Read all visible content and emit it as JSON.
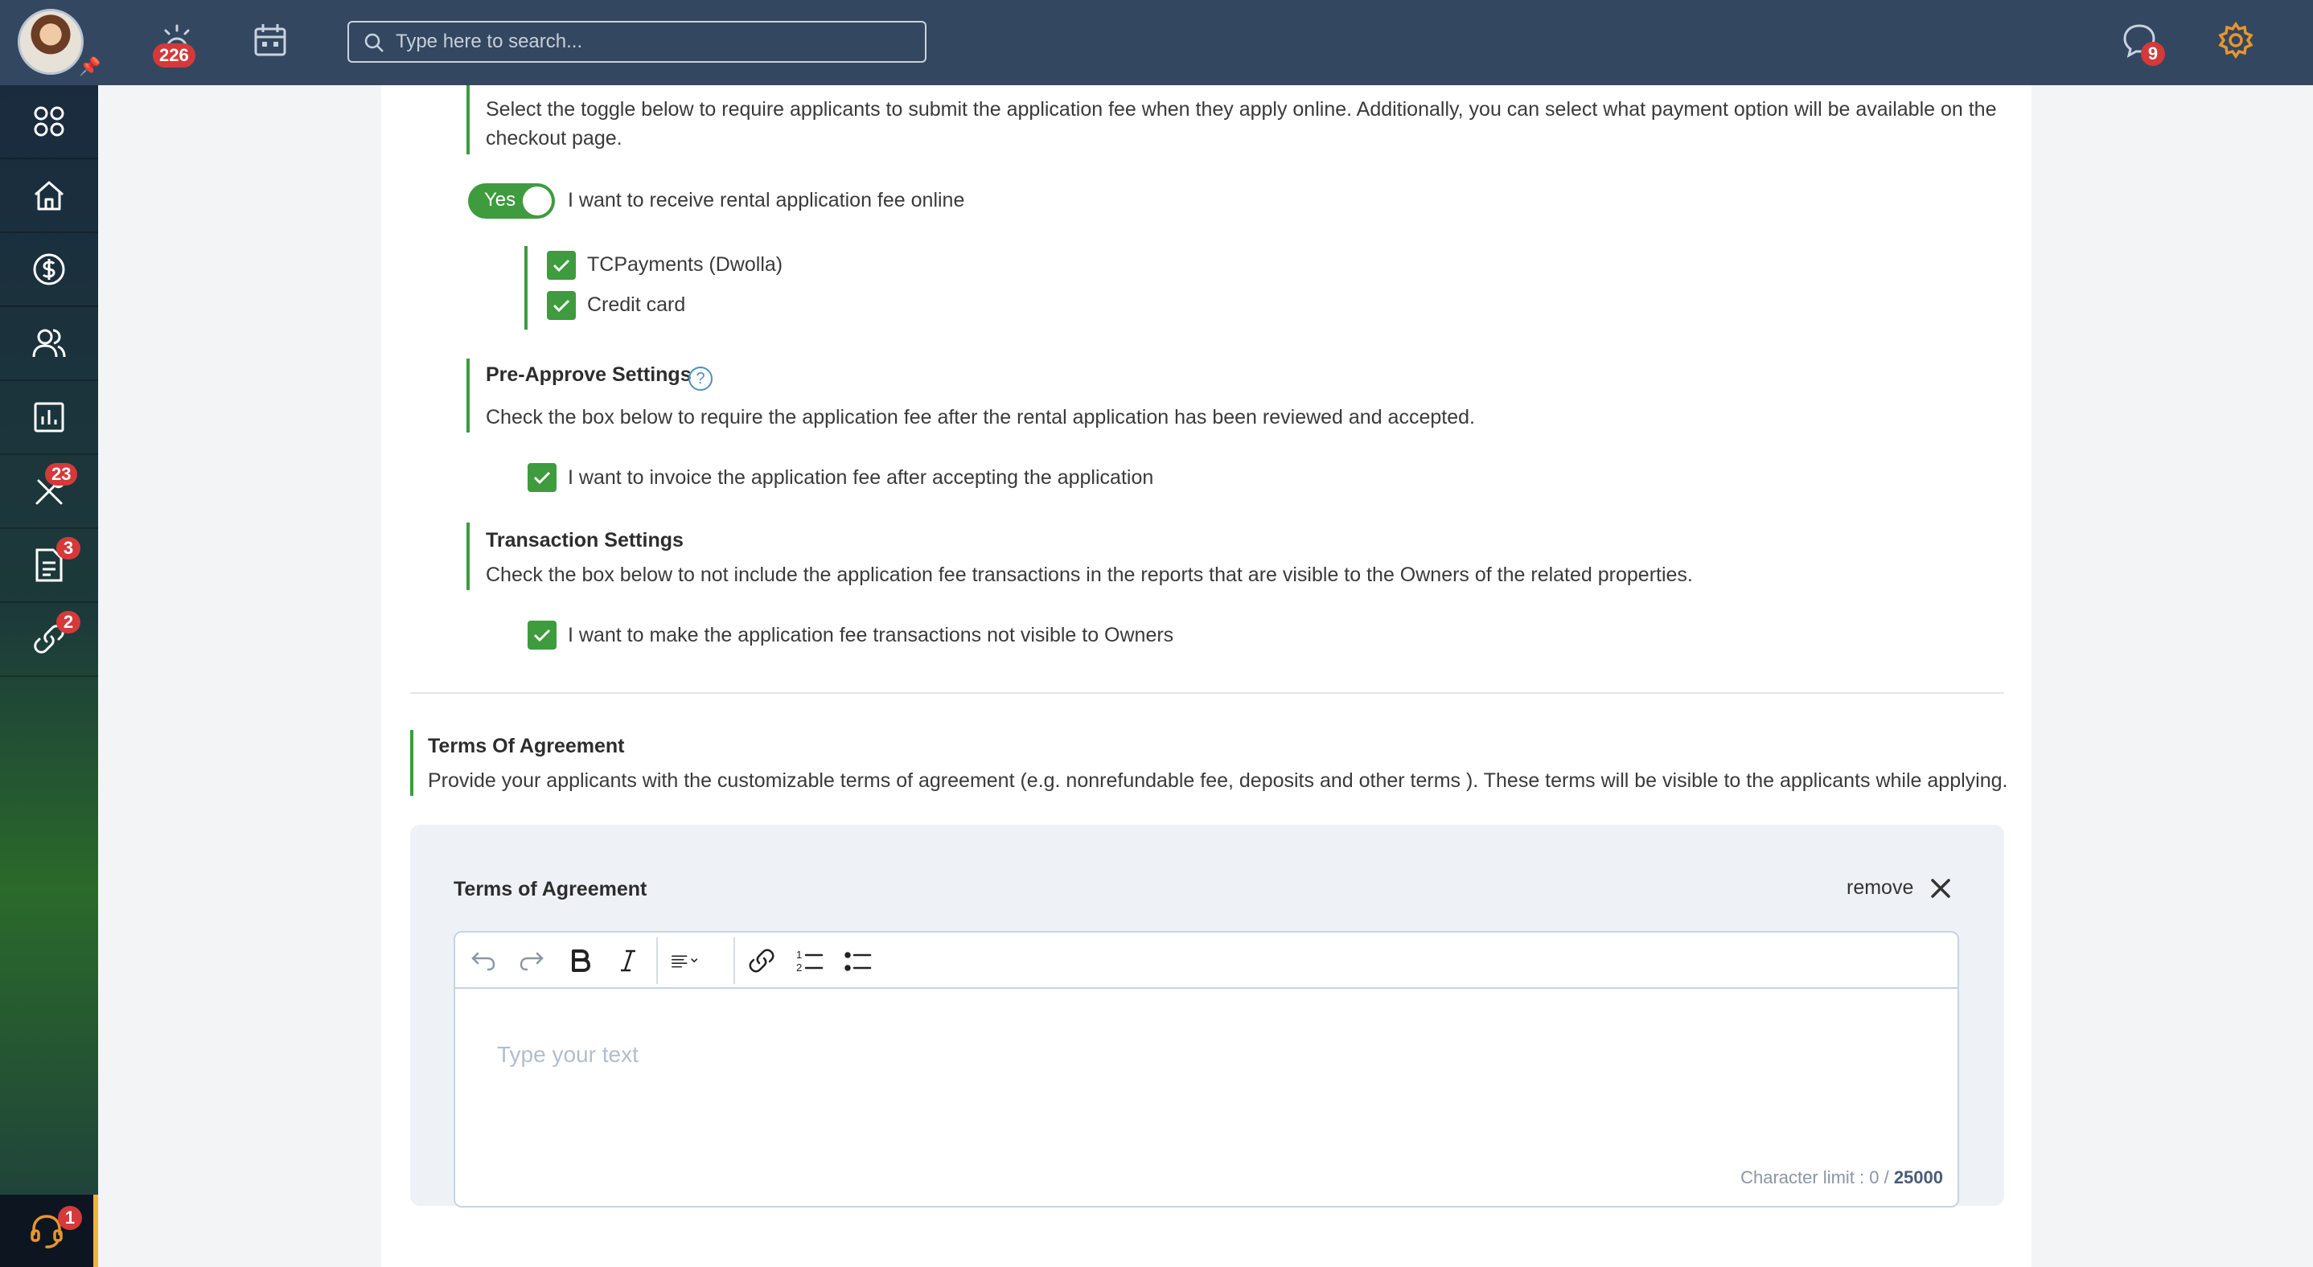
{
  "topbar": {
    "alerts_count": "226",
    "search_placeholder": "Type here to search...",
    "messages_count": "9"
  },
  "sidebar": {
    "items": [
      {
        "icon": "apps-grid-icon"
      },
      {
        "icon": "home-icon"
      },
      {
        "icon": "dollar-circle-icon"
      },
      {
        "icon": "users-icon"
      },
      {
        "icon": "bar-chart-icon"
      },
      {
        "icon": "tools-icon",
        "badge": "23"
      },
      {
        "icon": "document-icon",
        "badge": "3"
      },
      {
        "icon": "link-icon",
        "badge": "2"
      }
    ],
    "support_badge": "1"
  },
  "online_fee": {
    "description": "Select the toggle below to require applicants to submit the application fee when they apply online. Additionally, you can select what payment option will be available on the checkout page.",
    "toggle_label": "Yes",
    "toggle_on": true,
    "toggle_text": "I want to receive rental application fee online",
    "options": [
      {
        "label": "TCPayments (Dwolla)",
        "checked": true
      },
      {
        "label": "Credit card",
        "checked": true
      }
    ]
  },
  "pre_approve": {
    "title": "Pre-Approve Settings",
    "help": "?",
    "description": "Check the box below to require the application fee after the rental application has been reviewed and accepted.",
    "checkbox_label": "I want to invoice the application fee after accepting the application",
    "checked": true
  },
  "transaction": {
    "title": "Transaction Settings",
    "description": "Check the box below to not include the application fee transactions in the reports that are visible to the Owners of the related properties.",
    "checkbox_label": "I want to make the application fee transactions not visible to Owners",
    "checked": true
  },
  "terms": {
    "title": "Terms Of Agreement",
    "description": "Provide your applicants with the customizable terms of agreement (e.g. nonrefundable fee, deposits and other terms ). These terms will be visible to the applicants while applying.",
    "panel_title": "Terms of Agreement",
    "remove_label": "remove",
    "editor_placeholder": "Type your text",
    "char_limit_label": "Character limit : 0 / ",
    "char_limit_max": "25000"
  },
  "colors": {
    "topbar": "#344760",
    "accent_green": "#3e9b3e",
    "badge_red": "#d5393a",
    "gear_orange": "#e8962c"
  }
}
